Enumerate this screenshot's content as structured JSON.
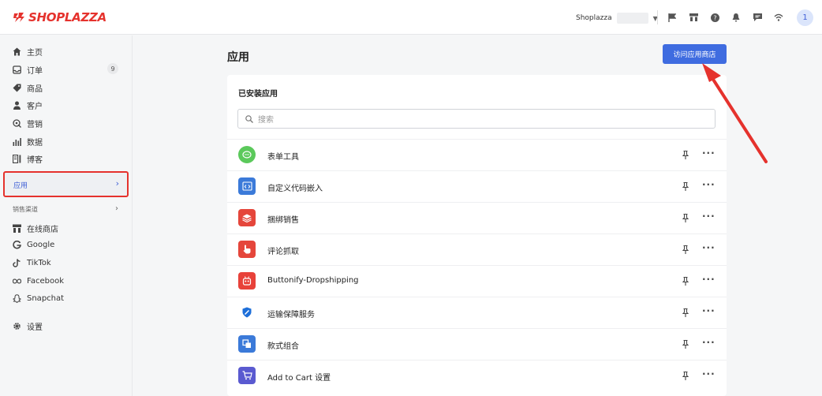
{
  "app": {
    "brand": "SHOPLAZZA"
  },
  "header": {
    "store_name": "Shoplazza",
    "avatar_initial": "1"
  },
  "sidebar": {
    "items": [
      {
        "label": "主页",
        "icon": "home-icon"
      },
      {
        "label": "订单",
        "icon": "orders-icon",
        "badge": "9"
      },
      {
        "label": "商品",
        "icon": "tag-icon"
      },
      {
        "label": "客户",
        "icon": "user-icon"
      },
      {
        "label": "营销",
        "icon": "marketing-icon"
      },
      {
        "label": "数据",
        "icon": "chart-icon"
      },
      {
        "label": "博客",
        "icon": "blog-icon"
      }
    ],
    "active": {
      "label": "应用"
    },
    "section_label": "销售渠道",
    "channels": [
      {
        "label": "在线商店",
        "icon": "store-icon"
      },
      {
        "label": "Google",
        "icon": "google-icon"
      },
      {
        "label": "TikTok",
        "icon": "tiktok-icon"
      },
      {
        "label": "Facebook",
        "icon": "facebook-icon"
      },
      {
        "label": "Snapchat",
        "icon": "snapchat-icon"
      }
    ],
    "settings_label": "设置"
  },
  "main": {
    "title": "应用",
    "visit_button": "访问应用商店",
    "card_title": "已安装应用",
    "search_placeholder": "搜索",
    "apps": [
      {
        "name": "表单工具",
        "color": "#5bc95b"
      },
      {
        "name": "自定义代码嵌入",
        "color": "#3b7ad9"
      },
      {
        "name": "捆绑销售",
        "color": "#e5463b"
      },
      {
        "name": "评论抓取",
        "color": "#e5463b"
      },
      {
        "name": "Buttonify-Dropshipping",
        "color": "#e8423a"
      },
      {
        "name": "运输保障服务",
        "color": "#1e6fd9"
      },
      {
        "name": "款式组合",
        "color": "#3b7ad9"
      },
      {
        "name": "Add to Cart 设置",
        "color": "#5a5ad0"
      }
    ]
  },
  "colors": {
    "accent": "#3f6ce0",
    "highlight": "#e5322d"
  }
}
